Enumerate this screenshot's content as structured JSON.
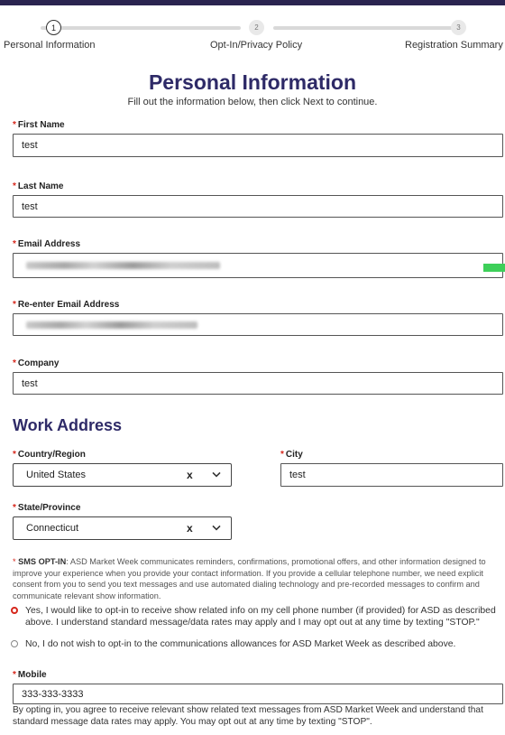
{
  "stepper": {
    "steps": [
      {
        "number": "1",
        "label": "Personal Information",
        "active": true
      },
      {
        "number": "2",
        "label": "Opt-In/Privacy Policy",
        "active": false
      },
      {
        "number": "3",
        "label": "Registration Summary",
        "active": false
      }
    ]
  },
  "header": {
    "title": "Personal Information",
    "subtitle": "Fill out the information below, then click Next to continue."
  },
  "required_marker": "*",
  "fields": {
    "first_name": {
      "label": "First Name",
      "value": "test"
    },
    "last_name": {
      "label": "Last Name",
      "value": "test"
    },
    "email": {
      "label": "Email Address",
      "value": ""
    },
    "email_confirm": {
      "label": "Re-enter Email Address",
      "value": ""
    },
    "company": {
      "label": "Company",
      "value": "test"
    }
  },
  "work_address": {
    "title": "Work Address",
    "country": {
      "label": "Country/Region",
      "value": "United States",
      "clear": "x"
    },
    "city": {
      "label": "City",
      "value": "test"
    },
    "state": {
      "label": "State/Province",
      "value": "Connecticut",
      "clear": "x"
    }
  },
  "sms": {
    "heading": "SMS OPT-IN",
    "text": ": ASD Market Week communicates reminders, confirmations, promotional offers, and other information designed to improve your experience when you provide your contact information. If you provide a cellular telephone number, we need explicit consent from you to send you text messages and use automated dialing technology and pre-recorded messages to confirm and communicate relevant show information.",
    "option_yes": "Yes, I would like to opt-in to receive show related info on my cell phone number (if provided) for ASD as described above. I understand standard message/data rates may apply and I may opt out at any time by texting \"STOP.\"",
    "option_no": "No, I do not wish to opt-in to the communications allowances for ASD Market Week as described above.",
    "selected": "yes"
  },
  "mobile": {
    "label": "Mobile",
    "value": "333-333-3333"
  },
  "footer": {
    "text": "By opting in, you agree to receive relevant show related text messages from ASD Market Week and understand that standard message data rates may apply. You may opt out at any time by texting \"STOP\"."
  },
  "colors": {
    "brand": "#2e2a67",
    "required": "#d6271c",
    "radio_selected": "#d6271c",
    "indicator": "#3dcf59"
  },
  "icons": {
    "country_dropdown": "chevron-down-icon",
    "state_dropdown": "chevron-down-icon",
    "clear": "clear-icon"
  }
}
